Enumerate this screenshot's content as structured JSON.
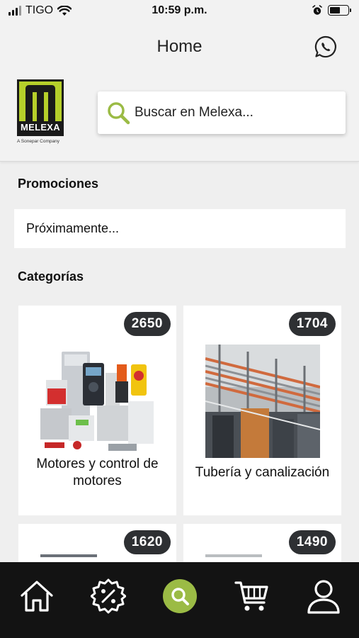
{
  "status_bar": {
    "carrier": "TIGO",
    "time": "10:59 p.m."
  },
  "header": {
    "title": "Home",
    "logo_text": "MELEXA",
    "logo_subtitle": "A Sonepar Company"
  },
  "search": {
    "placeholder": "Buscar en Melexa..."
  },
  "promotions": {
    "title": "Promociones",
    "text": "Próximamente..."
  },
  "categories": {
    "title": "Categorías",
    "items": [
      {
        "count": "2650",
        "label": "Motores y control de motores"
      },
      {
        "count": "1704",
        "label": "Tubería y canalización"
      },
      {
        "count": "1620",
        "label": ""
      },
      {
        "count": "1490",
        "label": ""
      }
    ]
  },
  "icons": {
    "whatsapp": "whatsapp-icon",
    "search": "search-icon",
    "nav": [
      "home-icon",
      "promotions-icon",
      "search-icon",
      "cart-icon",
      "profile-icon"
    ]
  },
  "colors": {
    "accent": "#9bbb45",
    "logo": "#b6cf2a",
    "badge": "#2e3033",
    "nav_bg": "#131313"
  }
}
